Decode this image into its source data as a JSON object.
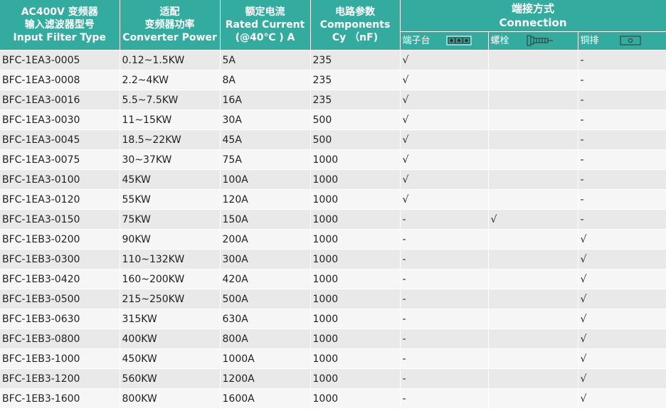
{
  "headers": {
    "model": [
      "AC400V 变频器",
      "输入滤波器型号",
      "Input Filter Type"
    ],
    "power": [
      "适配",
      "变频器功率",
      "Converter Power"
    ],
    "current": [
      "额定电流",
      "Rated Current",
      "(@40℃ ) A"
    ],
    "cy": [
      "电路参数",
      "Components",
      "Cy （nF)"
    ],
    "connection": [
      "端接方式",
      "Connection"
    ],
    "connection_types": [
      {
        "label": "端子台",
        "icon": "terminal-block-icon"
      },
      {
        "label": "螺栓",
        "icon": "bolt-icon"
      },
      {
        "label": "铜排",
        "icon": "copper-bar-icon"
      }
    ]
  },
  "colors": {
    "header_bg": "#33ab9f",
    "header_text": "#ffffff",
    "row_odd": "#e9e9e9",
    "row_even": "#f6f6f6"
  },
  "rows": [
    {
      "model": "BFC-1EA3-0005",
      "power": "0.12~1.5KW",
      "current": "5A",
      "cy": "235",
      "terminal": "√",
      "bolt": "",
      "copper": "-"
    },
    {
      "model": "BFC-1EA3-0008",
      "power": "2.2~4KW",
      "current": "8A",
      "cy": "235",
      "terminal": "√",
      "bolt": "",
      "copper": "-"
    },
    {
      "model": "BFC-1EA3-0016",
      "power": "5.5~7.5KW",
      "current": "16A",
      "cy": "235",
      "terminal": "√",
      "bolt": "",
      "copper": "-"
    },
    {
      "model": "BFC-1EA3-0030",
      "power": "11~15KW",
      "current": "30A",
      "cy": "500",
      "terminal": "√",
      "bolt": "",
      "copper": "-"
    },
    {
      "model": "BFC-1EA3-0045",
      "power": "18.5~22KW",
      "current": "45A",
      "cy": "500",
      "terminal": "√",
      "bolt": "",
      "copper": "-"
    },
    {
      "model": "BFC-1EA3-0075",
      "power": "30~37KW",
      "current": "75A",
      "cy": "1000",
      "terminal": "√",
      "bolt": "",
      "copper": "-"
    },
    {
      "model": "BFC-1EA3-0100",
      "power": "45KW",
      "current": "100A",
      "cy": "1000",
      "terminal": "√",
      "bolt": "",
      "copper": "-"
    },
    {
      "model": "BFC-1EA3-0120",
      "power": "55KW",
      "current": "120A",
      "cy": "1000",
      "terminal": "√",
      "bolt": "",
      "copper": "-"
    },
    {
      "model": "BFC-1EA3-0150",
      "power": "75KW",
      "current": "150A",
      "cy": "1000",
      "terminal": "-",
      "bolt": "√",
      "copper": "-"
    },
    {
      "model": "BFC-1EB3-0200",
      "power": "90KW",
      "current": "200A",
      "cy": "1000",
      "terminal": "-",
      "bolt": "",
      "copper": "√"
    },
    {
      "model": "BFC-1EB3-0300",
      "power": "110~132KW",
      "current": "300A",
      "cy": "1000",
      "terminal": "-",
      "bolt": "",
      "copper": "√"
    },
    {
      "model": "BFC-1EB3-0420",
      "power": "160~200KW",
      "current": "420A",
      "cy": "1000",
      "terminal": "-",
      "bolt": "",
      "copper": "√"
    },
    {
      "model": "BFC-1EB3-0500",
      "power": "215~250KW",
      "current": "500A",
      "cy": "1000",
      "terminal": "-",
      "bolt": "",
      "copper": "√"
    },
    {
      "model": "BFC-1EB3-0630",
      "power": "315KW",
      "current": "630A",
      "cy": "1000",
      "terminal": "-",
      "bolt": "",
      "copper": "√"
    },
    {
      "model": "BFC-1EB3-0800",
      "power": "400KW",
      "current": "800A",
      "cy": "1000",
      "terminal": "-",
      "bolt": "",
      "copper": "√"
    },
    {
      "model": "BFC-1EB3-1000",
      "power": "450KW",
      "current": "1000A",
      "cy": "1000",
      "terminal": "-",
      "bolt": "",
      "copper": "√"
    },
    {
      "model": "BFC-1EB3-1200",
      "power": "560KW",
      "current": "1200A",
      "cy": "1000",
      "terminal": "-",
      "bolt": "",
      "copper": "√"
    },
    {
      "model": "BFC-1EB3-1600",
      "power": "800KW",
      "current": "1600A",
      "cy": "1000",
      "terminal": "-",
      "bolt": "",
      "copper": "√"
    }
  ]
}
